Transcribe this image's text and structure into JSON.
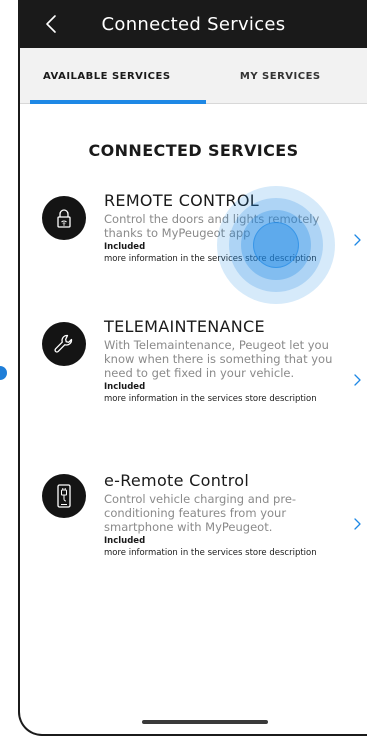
{
  "header": {
    "title": "Connected Services",
    "back_icon": "chevron-left-icon"
  },
  "tabs": [
    {
      "label": "AVAILABLE SERVICES",
      "active": true
    },
    {
      "label": "MY SERVICES",
      "active": false
    }
  ],
  "page_title": "CONNECTED SERVICES",
  "services": [
    {
      "icon": "lock-wifi-icon",
      "name": "REMOTE CONTROL",
      "description": "Control the doors and lights remotely thanks to MyPeugeot app",
      "status": "Included",
      "more": "more information in the services store description"
    },
    {
      "icon": "wrench-icon",
      "name": "TELEMAINTENANCE",
      "description": "With Telemaintenance, Peugeot let you know when there is something that you need to get fixed in your vehicle.",
      "status": "Included",
      "more": "more information in the services store description"
    },
    {
      "icon": "phone-charging-icon",
      "name": "e-Remote Control",
      "description": "Control vehicle charging and pre-conditioning features from your smartphone with MyPeugeot.",
      "status": "Included",
      "more": "more information in the services store description"
    }
  ],
  "colors": {
    "accent": "#1e88e5",
    "header_bg": "#1a1a1a",
    "tab_bg": "#f2f2f2",
    "description_text": "#8a8a8a"
  }
}
